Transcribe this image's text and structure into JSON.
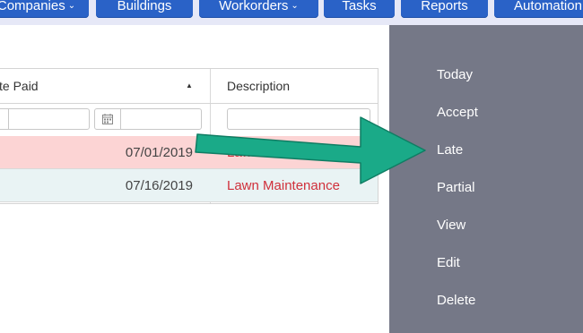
{
  "nav": {
    "items": [
      {
        "label": "Companies",
        "chevron": true
      },
      {
        "label": "Buildings",
        "chevron": false
      },
      {
        "label": "Workorders",
        "chevron": true
      },
      {
        "label": "Tasks",
        "chevron": false
      },
      {
        "label": "Reports",
        "chevron": false
      },
      {
        "label": "Automation",
        "chevron": false
      }
    ],
    "chevron_glyph": "⌄"
  },
  "grid": {
    "columns": [
      {
        "label": "te Paid",
        "sort": "ascending",
        "sort_glyph": "▲"
      },
      {
        "label": "Description"
      }
    ],
    "filter_values": [
      "",
      "",
      ""
    ],
    "rows": [
      {
        "date": "07/01/2019",
        "description": "Lawn Mainte…",
        "status": "late",
        "status_color": "#fcd4d4"
      },
      {
        "date": "07/16/2019",
        "description": "Lawn Maintenance",
        "status": "normal",
        "status_color": "#e9f3f4"
      }
    ],
    "description_color": "#d0303b"
  },
  "context_menu": {
    "items": [
      "Today",
      "Accept",
      "Late",
      "Partial",
      "View",
      "Edit",
      "Delete"
    ],
    "background": "#757887"
  },
  "annotation": {
    "arrow_color": "#1aaa88",
    "points_to": "Late"
  },
  "colors": {
    "nav_button": "#2a62c7",
    "nav_bar": "#e6e8f7"
  }
}
